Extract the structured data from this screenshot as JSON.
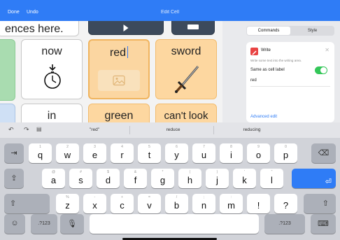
{
  "topbar": {
    "done": "Done",
    "undo": "Undo",
    "title": "Edit Cell"
  },
  "grid": {
    "partial_top_label": "ences here.",
    "cells": {
      "now": "now",
      "red": "red",
      "sword": "sword",
      "in": "in",
      "green": "green",
      "cant_look": "can't look"
    }
  },
  "panel": {
    "tabs": {
      "commands": "Commands",
      "style": "Style"
    },
    "write": {
      "title": "Write",
      "description": "Write some text into the writing area.",
      "same_as_label": "Same as cell label",
      "toggle_on": true,
      "value": "red",
      "advanced": "Advanced edit"
    }
  },
  "keyboard": {
    "suggestions": [
      "\"red\"",
      "reduce",
      "reducing"
    ],
    "row1": [
      {
        "ch": "q",
        "alt": "1"
      },
      {
        "ch": "w",
        "alt": "2"
      },
      {
        "ch": "e",
        "alt": "3"
      },
      {
        "ch": "r",
        "alt": "4"
      },
      {
        "ch": "t",
        "alt": "5"
      },
      {
        "ch": "y",
        "alt": "6"
      },
      {
        "ch": "u",
        "alt": "7"
      },
      {
        "ch": "i",
        "alt": "8"
      },
      {
        "ch": "o",
        "alt": "9"
      },
      {
        "ch": "p",
        "alt": "0"
      }
    ],
    "row2": [
      {
        "ch": "a",
        "alt": "@"
      },
      {
        "ch": "s",
        "alt": "#"
      },
      {
        "ch": "d",
        "alt": "$"
      },
      {
        "ch": "f",
        "alt": "&"
      },
      {
        "ch": "g",
        "alt": "*"
      },
      {
        "ch": "h",
        "alt": "("
      },
      {
        "ch": "j",
        "alt": ")"
      },
      {
        "ch": "k",
        "alt": "'"
      },
      {
        "ch": "l",
        "alt": "\""
      }
    ],
    "row3": [
      {
        "ch": "z",
        "alt": "%"
      },
      {
        "ch": "x",
        "alt": "-"
      },
      {
        "ch": "c",
        "alt": "+"
      },
      {
        "ch": "v",
        "alt": "="
      },
      {
        "ch": "b",
        "alt": "/"
      },
      {
        "ch": "n",
        "alt": ";"
      },
      {
        "ch": "m",
        "alt": ":"
      },
      {
        "ch": "!",
        "alt": ""
      },
      {
        "ch": "?",
        "alt": ""
      }
    ],
    "num_left": ".?123",
    "num_right": ".?123",
    "colors": {
      "accent": "#2f7cf6",
      "toggle": "#34c759"
    }
  }
}
